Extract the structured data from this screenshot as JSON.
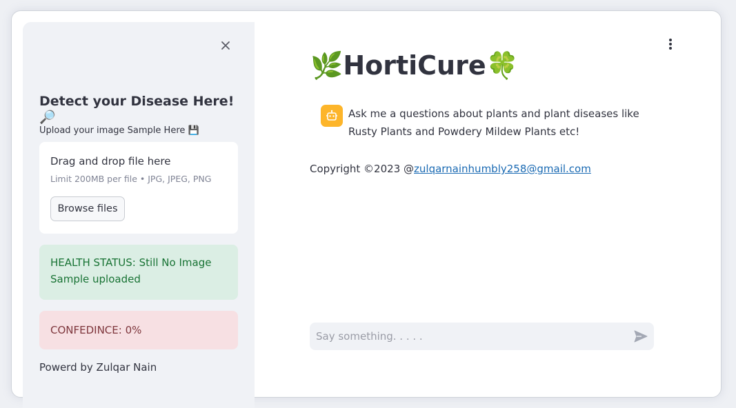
{
  "sidebar": {
    "title": "Detect your Disease Here! 🔎",
    "upload_label": "Upload your image Sample Here 💾",
    "uploader": {
      "drag_text": "Drag and drop file here",
      "limit_text": "Limit 200MB per file • JPG, JPEG, PNG",
      "browse_label": "Browse files"
    },
    "health_status": "HEALTH STATUS: Still No Image Sample uploaded",
    "confidence": "CONFEDINCE: 0%",
    "powered_by": "Powerd by Zulqar Nain"
  },
  "main": {
    "title": "🌿HortiCure🍀",
    "chat_message": "Ask me a questions about plants and plant diseases like Rusty Plants and Powdery Mildew Plants etc!",
    "copyright_prefix": "Copyright ©2023 @",
    "copyright_email": "zulqarnainhumbly258@gmail.com",
    "chat_input_placeholder": "Say something. . . . ."
  },
  "icons": {
    "close": "close-icon",
    "menu": "kebab-menu-icon",
    "bot": "robot-icon",
    "send": "send-icon"
  },
  "colors": {
    "sidebar_bg": "#f0f2f6",
    "success_bg": "#dbeee4",
    "success_text": "#177233",
    "error_bg": "#f7e0e3",
    "error_text": "#7d353b",
    "bot_avatar": "#fdb52a",
    "link": "#1a6ab3"
  }
}
